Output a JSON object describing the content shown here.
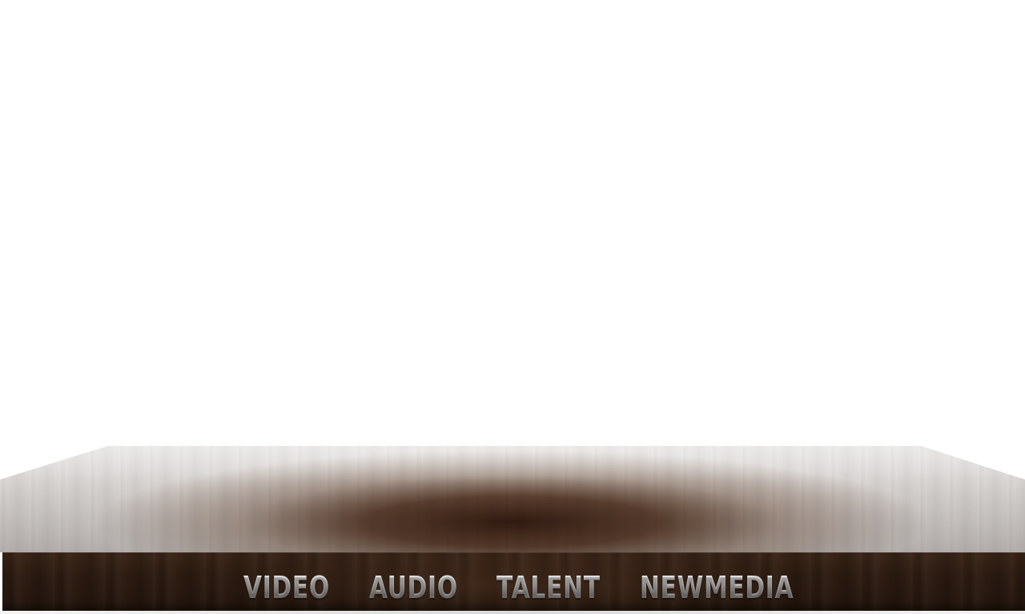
{
  "nav": {
    "items": [
      {
        "label": "VIDEO"
      },
      {
        "label": "AUDIO"
      },
      {
        "label": "TALENT"
      },
      {
        "label": "NEWMEDIA"
      }
    ]
  },
  "colors": {
    "background": "#ffffff",
    "wood_dark": "#24160e",
    "wood_mid": "#3a2518",
    "table_surface": "#d7d3d1",
    "nav_text": "#dcdad8"
  }
}
